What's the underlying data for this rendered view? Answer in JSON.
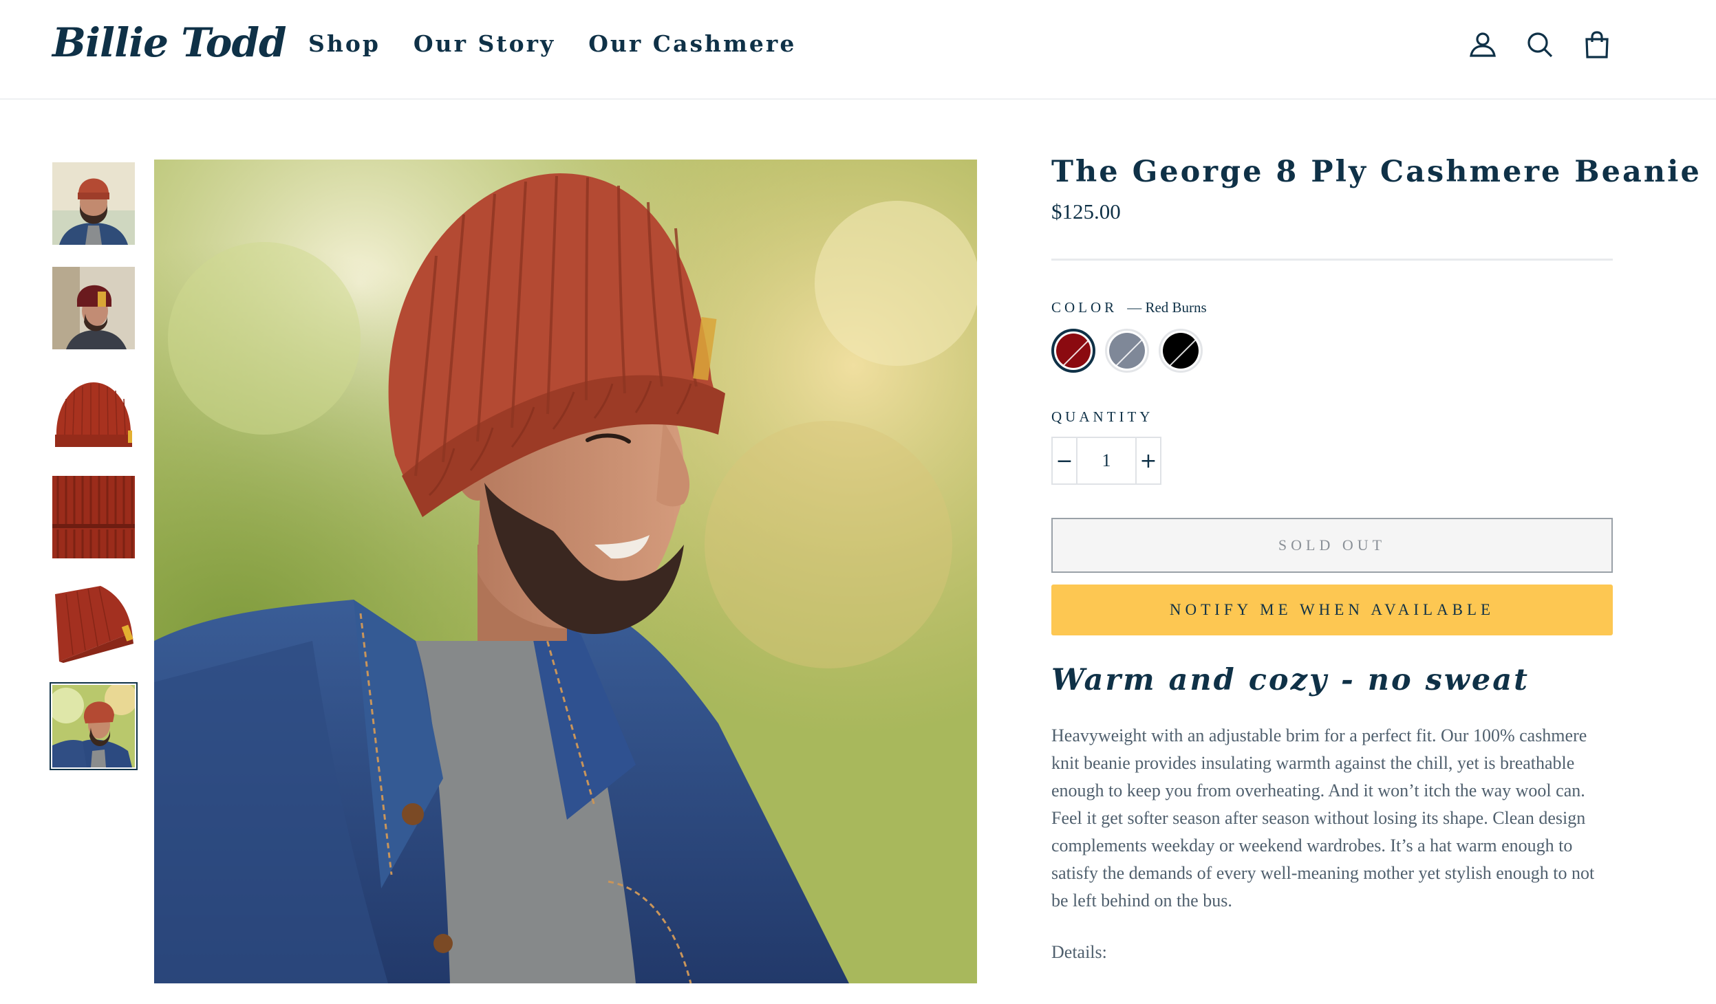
{
  "brand": {
    "logo_text": "Billie Todd"
  },
  "nav": {
    "items": [
      {
        "label": "Shop"
      },
      {
        "label": "Our Story"
      },
      {
        "label": "Our Cashmere"
      }
    ]
  },
  "header_icons": [
    "account-icon",
    "search-icon",
    "cart-icon"
  ],
  "gallery": {
    "thumbnails": [
      {
        "name": "man-wearing-beanie-front"
      },
      {
        "name": "man-wearing-beanie-profile"
      },
      {
        "name": "beanie-flat-front"
      },
      {
        "name": "beanie-knit-closeup"
      },
      {
        "name": "beanie-flat-side"
      },
      {
        "name": "man-wearing-beanie-denim-jacket",
        "selected": true
      }
    ],
    "selected_index": 5
  },
  "product": {
    "title": "The George 8 Ply Cashmere Beanie",
    "price": "$125.00",
    "color_label": "COLOR",
    "color_value": "— Red Burns",
    "swatches": [
      {
        "name": "Red Burns",
        "color": "#8b0a10",
        "active": true
      },
      {
        "name": "Grey",
        "color": "#7f8898",
        "active": false
      },
      {
        "name": "Black",
        "color": "#000000",
        "active": false
      }
    ],
    "quantity_label": "QUANTITY",
    "quantity": "1",
    "minus_symbol": "−",
    "plus_symbol": "+",
    "sold_out_label": "SOLD OUT",
    "notify_label": "NOTIFY ME WHEN AVAILABLE",
    "tagline": "Warm and cozy - no sweat",
    "description": "Heavyweight with an adjustable brim for a perfect fit. Our 100% cashmere knit beanie provides insulating warmth against the chill, yet is breathable enough to keep you from overheating. And it won’t itch the way wool can. Feel it get softer season after season without losing its shape. Clean design complements weekday or weekend wardrobes. It’s a hat warm enough to satisfy the demands of every well-meaning mother yet stylish enough to not be left behind on the bus.",
    "details_label": "Details:"
  },
  "colors": {
    "brand_navy": "#0f3147",
    "notify_yellow": "#fdc752",
    "beanie_rust": "#b44a33"
  }
}
